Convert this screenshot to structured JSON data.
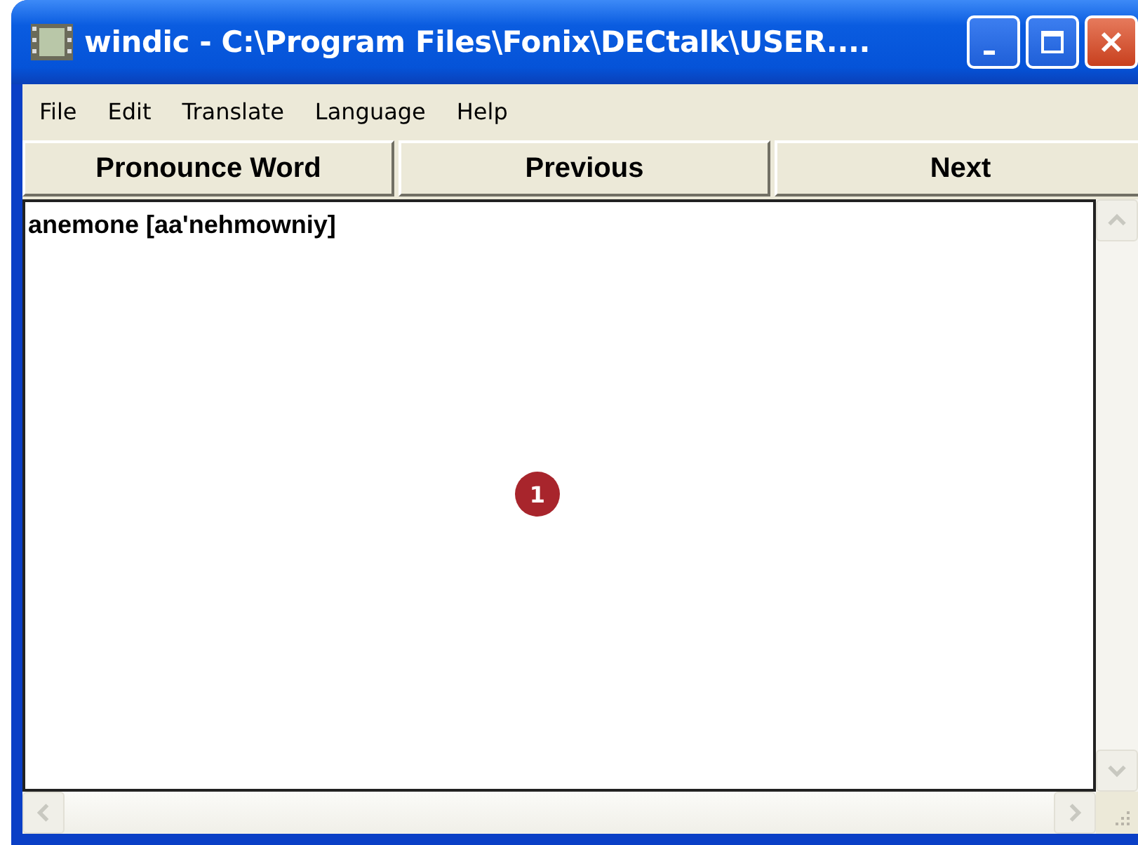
{
  "window": {
    "title": "windic - C:\\Program Files\\Fonix\\DECtalk\\USER...."
  },
  "menu": [
    {
      "label": "File"
    },
    {
      "label": "Edit"
    },
    {
      "label": "Translate"
    },
    {
      "label": "Language"
    },
    {
      "label": "Help"
    }
  ],
  "buttons": [
    {
      "label": "Pronounce Word"
    },
    {
      "label": "Previous"
    },
    {
      "label": "Next"
    }
  ],
  "editor": {
    "text": "anemone [aa'nehmowniy]"
  },
  "callouts": [
    {
      "label": "1"
    }
  ]
}
